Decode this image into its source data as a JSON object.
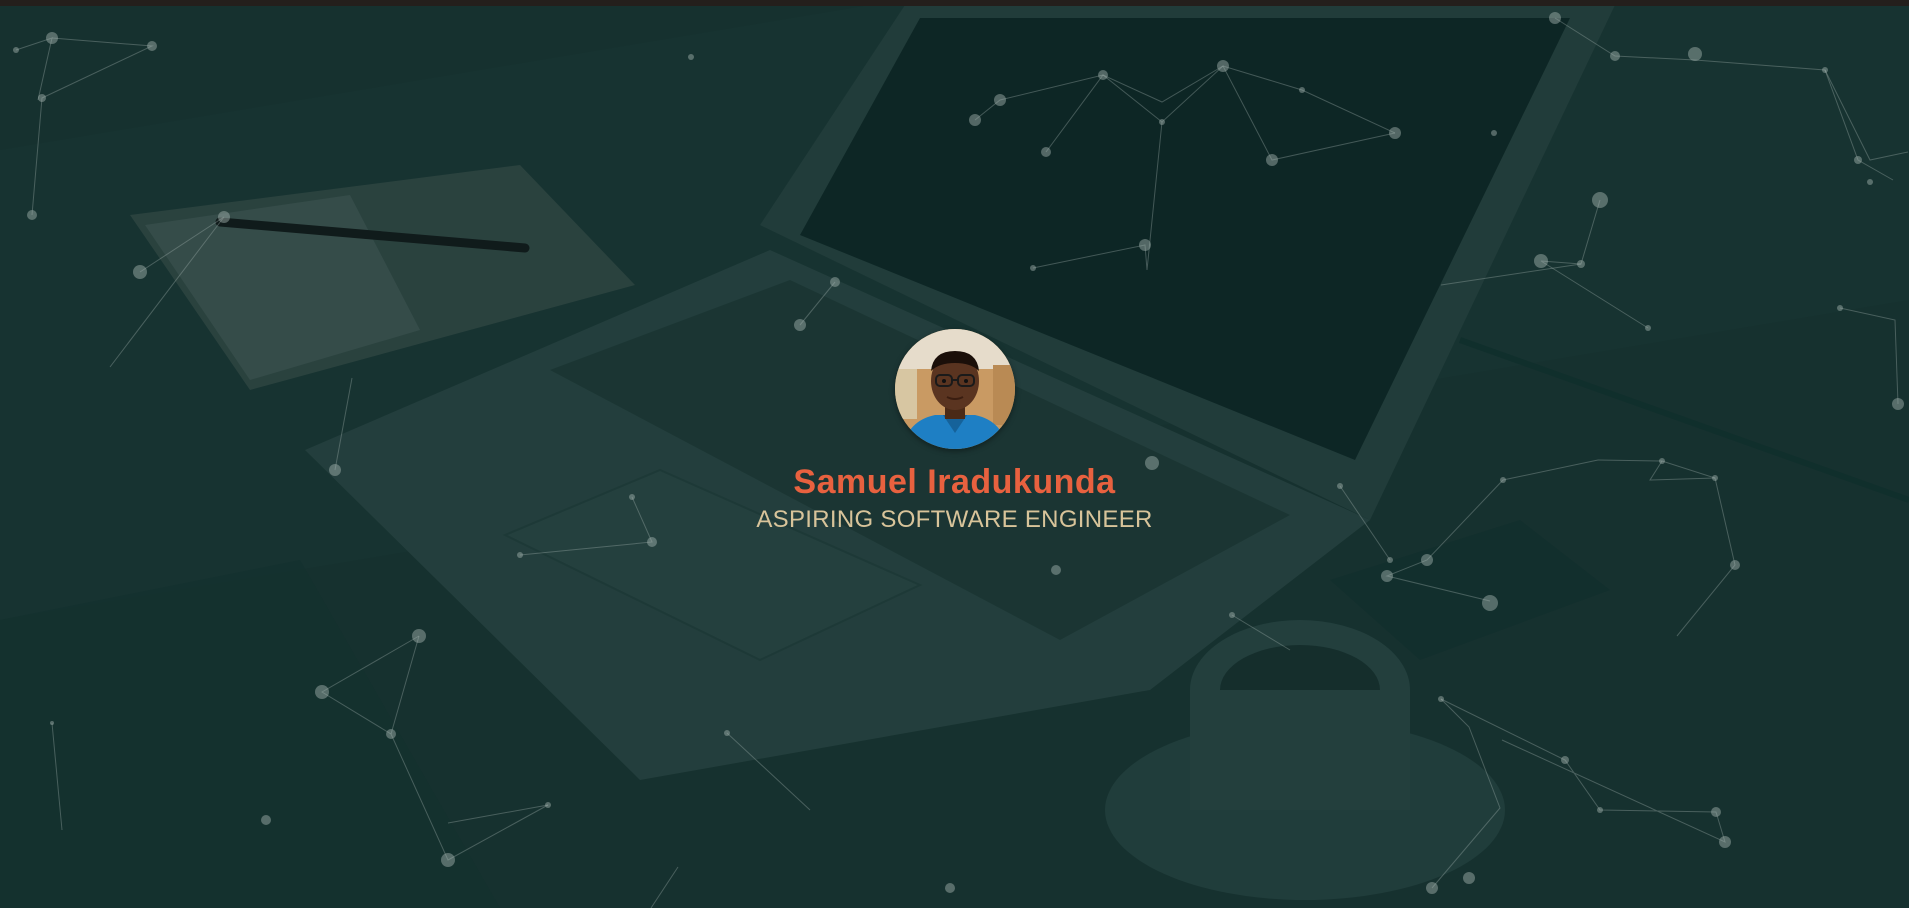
{
  "profile": {
    "name": "Samuel Iradukunda",
    "title": "ASPIRING SOFTWARE ENGINEER",
    "avatar_icon": "person-photo-icon"
  },
  "colors": {
    "name": "#e8613f",
    "title": "#d8c49a",
    "overlay": "#14312f",
    "particles": "#a9b8b4"
  }
}
